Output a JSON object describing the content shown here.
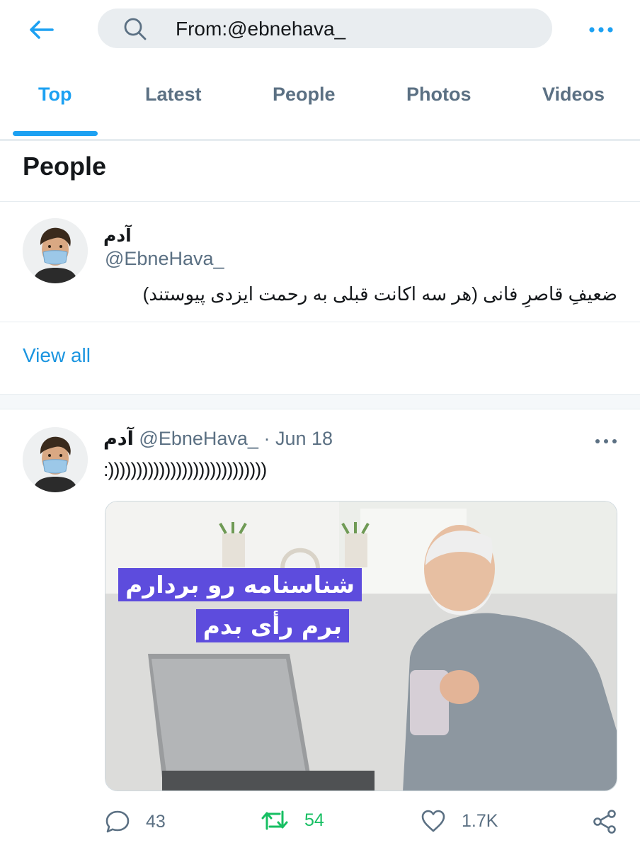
{
  "search": {
    "query": "From:@ebnehava_"
  },
  "tabs": [
    {
      "label": "Top",
      "active": true
    },
    {
      "label": "Latest",
      "active": false
    },
    {
      "label": "People",
      "active": false
    },
    {
      "label": "Photos",
      "active": false
    },
    {
      "label": "Videos",
      "active": false
    }
  ],
  "people_section": {
    "title": "People",
    "user": {
      "name": "آدم",
      "handle": "@EbneHava_",
      "bio": "ضعیفِ قاصرِ فانی (هر سه اکانت قبلی به رحمت ایزدی پیوستند)"
    },
    "view_all": "View all"
  },
  "tweet": {
    "name": "آدم",
    "handle": "@EbneHava_",
    "dot": "·",
    "date": "Jun 18",
    "text": ":))))))))))))))))))))))))))))",
    "image_caption_line1": "شناسنامه رو بردارم",
    "image_caption_line2": "برم رأی بدم",
    "replies": "43",
    "retweets": "54",
    "likes": "1.7K"
  },
  "colors": {
    "accent": "#1da1f2",
    "retweet": "#17bf63",
    "muted": "#5b7083",
    "caption_bg": "#5d4cdd"
  },
  "icons": [
    "back-arrow-icon",
    "search-icon",
    "more-dots-icon",
    "reply-icon",
    "retweet-icon",
    "like-icon",
    "share-icon"
  ]
}
